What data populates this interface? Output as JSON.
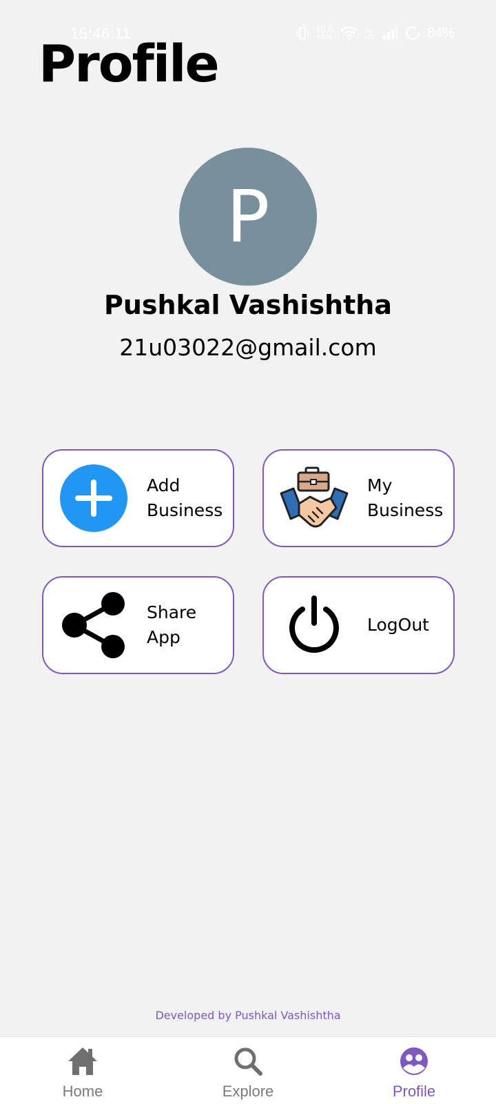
{
  "status_bar": {
    "time": "15:46:11",
    "speed_top": "15.0",
    "speed_bottom": "KB/S",
    "battery": "84%"
  },
  "header": {
    "title": "Profile"
  },
  "profile": {
    "avatar_letter": "P",
    "avatar_color": "#78909c",
    "name": "Pushkal Vashishtha",
    "email": "21u03022@gmail.com"
  },
  "actions": {
    "add_business": {
      "label": "Add\nBusiness",
      "icon": "plus-circle-icon"
    },
    "my_business": {
      "label": "My\nBusiness",
      "icon": "handshake-briefcase-icon"
    },
    "share_app": {
      "label": "Share\nApp",
      "icon": "share-icon"
    },
    "logout": {
      "label": "LogOut",
      "icon": "power-icon"
    }
  },
  "footer": {
    "credit": "Developed by Pushkal Vashishtha"
  },
  "bottom_nav": {
    "items": [
      {
        "label": "Home",
        "icon": "home-icon",
        "active": false
      },
      {
        "label": "Explore",
        "icon": "search-icon",
        "active": false
      },
      {
        "label": "Profile",
        "icon": "profile-icon",
        "active": true
      }
    ]
  },
  "colors": {
    "accent": "#7e57c2",
    "add_blue": "#2196f3",
    "background": "#f2f2f2"
  }
}
